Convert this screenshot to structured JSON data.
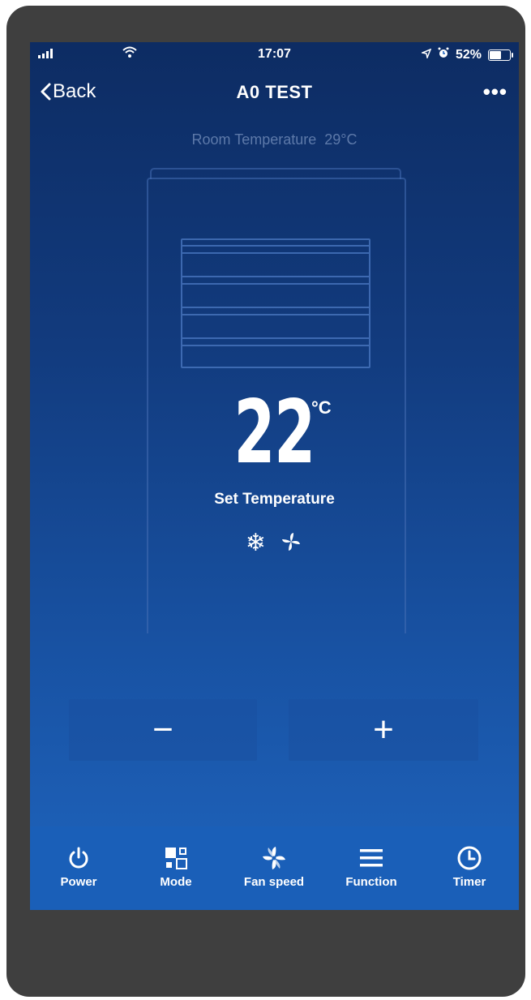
{
  "status_bar": {
    "time": "17:07",
    "battery": "52%"
  },
  "nav": {
    "back_label": "Back",
    "title": "A0 TEST",
    "more_label": "•••"
  },
  "room_temperature": {
    "label": "Room Temperature",
    "value": "29°C"
  },
  "set_temperature": {
    "value": "22",
    "unit": "°C",
    "label": "Set Temperature"
  },
  "mode_icons": {
    "cool": "❄",
    "fan": "fan-icon"
  },
  "buttons": {
    "decrease": "−",
    "increase": "+"
  },
  "toolbar": {
    "items": [
      {
        "label": "Power",
        "icon": "power-icon"
      },
      {
        "label": "Mode",
        "icon": "mode-icon"
      },
      {
        "label": "Fan speed",
        "icon": "fan-speed-icon"
      },
      {
        "label": "Function",
        "icon": "menu-icon"
      },
      {
        "label": "Timer",
        "icon": "clock-icon"
      }
    ]
  },
  "colors": {
    "screen_top": "#0d2c63",
    "screen_bottom": "#1f64bd",
    "toolbar": "#1a5fb8",
    "room_text": "#5d79a9",
    "phone_frame": "#3f3f3f"
  }
}
